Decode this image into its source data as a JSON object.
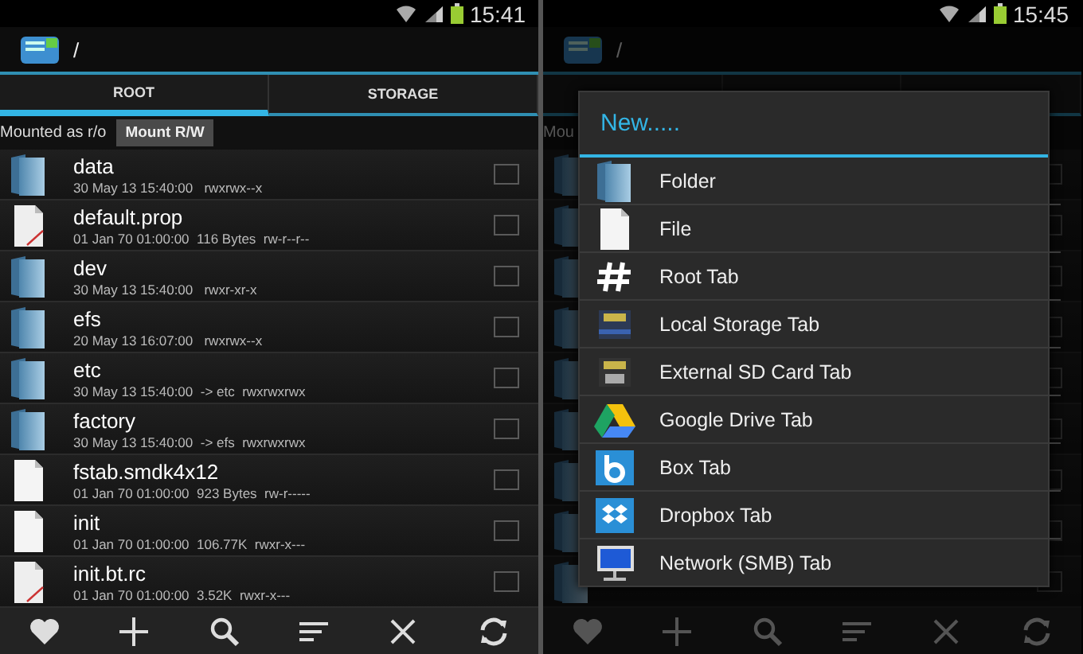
{
  "screens": [
    {
      "status_bar": {
        "time": "15:41"
      },
      "header": {
        "path": "/"
      },
      "tabs": [
        {
          "label": "ROOT",
          "selected": true
        },
        {
          "label": "STORAGE",
          "selected": false
        }
      ],
      "mount": {
        "status": "Mounted as r/o",
        "button": "Mount R/W"
      },
      "files": [
        {
          "name": "data",
          "details": "30 May 13 15:40:00   rwxrwx--x",
          "kind": "folder",
          "checked": false
        },
        {
          "name": "default.prop",
          "details": "01 Jan 70 01:00:00  116 Bytes  rw-r--r--",
          "kind": "document",
          "checked": false
        },
        {
          "name": "dev",
          "details": "30 May 13 15:40:00   rwxr-xr-x",
          "kind": "folder",
          "checked": false
        },
        {
          "name": "efs",
          "details": "20 May 13 16:07:00   rwxrwx--x",
          "kind": "folder",
          "checked": false
        },
        {
          "name": "etc",
          "details": "30 May 13 15:40:00  -> etc  rwxrwxrwx",
          "kind": "folder",
          "checked": false
        },
        {
          "name": "factory",
          "details": "30 May 13 15:40:00  -> efs  rwxrwxrwx",
          "kind": "folder",
          "checked": false
        },
        {
          "name": "fstab.smdk4x12",
          "details": "01 Jan 70 01:00:00  923 Bytes  rw-r-----",
          "kind": "file",
          "checked": false
        },
        {
          "name": "init",
          "details": "01 Jan 70 01:00:00  106.77K  rwxr-x---",
          "kind": "file",
          "checked": false
        },
        {
          "name": "init.bt.rc",
          "details": "01 Jan 70 01:00:00  3.52K  rwxr-x---",
          "kind": "document",
          "checked": false
        }
      ]
    },
    {
      "status_bar": {
        "time": "15:45"
      },
      "header": {
        "path": "/"
      },
      "mount": {
        "status": "Mou"
      },
      "files": [
        {
          "kind": "folder",
          "checked": false
        },
        {
          "kind": "folder",
          "checked": false
        },
        {
          "kind": "folder",
          "checked": false
        },
        {
          "kind": "folder",
          "checked": false
        },
        {
          "kind": "folder",
          "checked": false
        },
        {
          "kind": "folder",
          "checked": false
        },
        {
          "kind": "folder",
          "checked": false
        },
        {
          "kind": "folder",
          "checked": false
        },
        {
          "kind": "folder",
          "checked": false
        }
      ],
      "dialog": {
        "title": "New.....",
        "items": [
          {
            "label": "Folder",
            "kind": "folder"
          },
          {
            "label": "File",
            "kind": "file"
          },
          {
            "label": "Root Tab",
            "kind": "hash"
          },
          {
            "label": "Local Storage Tab",
            "kind": "storage"
          },
          {
            "label": "External SD Card Tab",
            "kind": "sdcard"
          },
          {
            "label": "Google Drive Tab",
            "kind": "drive"
          },
          {
            "label": "Box Tab",
            "kind": "box"
          },
          {
            "label": "Dropbox Tab",
            "kind": "dropbox"
          },
          {
            "label": "Network (SMB) Tab",
            "kind": "network"
          }
        ]
      }
    }
  ]
}
